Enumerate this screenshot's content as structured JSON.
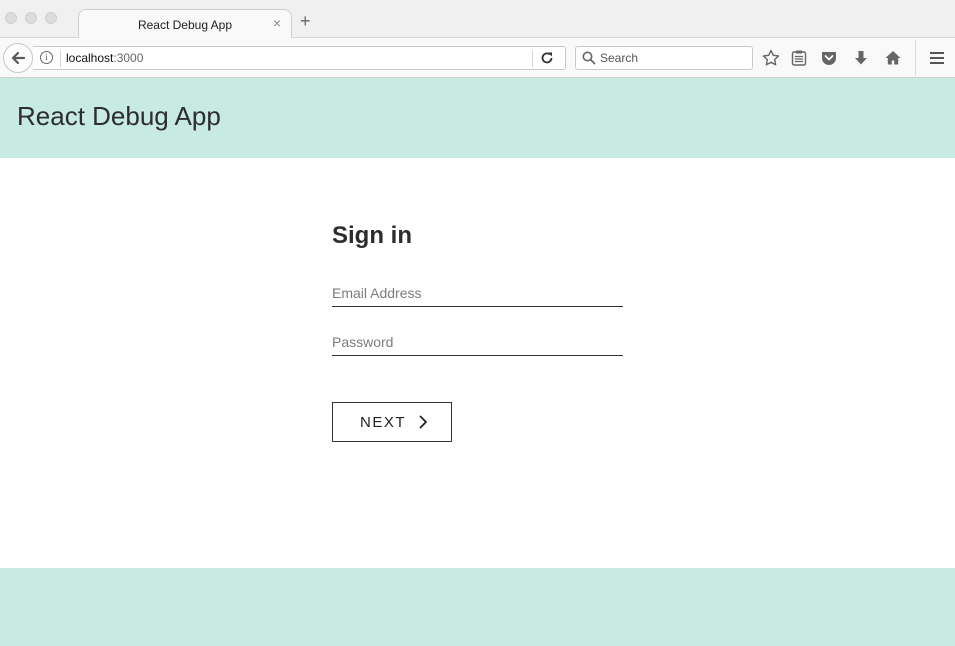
{
  "browser": {
    "tab_title": "React Debug App",
    "tab_close": "×",
    "new_tab": "+",
    "url_host": "localhost",
    "url_port": ":3000",
    "search_placeholder": "Search"
  },
  "app": {
    "title": "React Debug App"
  },
  "signin": {
    "heading": "Sign in",
    "email_placeholder": "Email Address",
    "password_placeholder": "Password",
    "next_label": "NEXT"
  },
  "colors": {
    "header_bg": "#c7eae3",
    "footer_bg": "#c7eae3"
  }
}
